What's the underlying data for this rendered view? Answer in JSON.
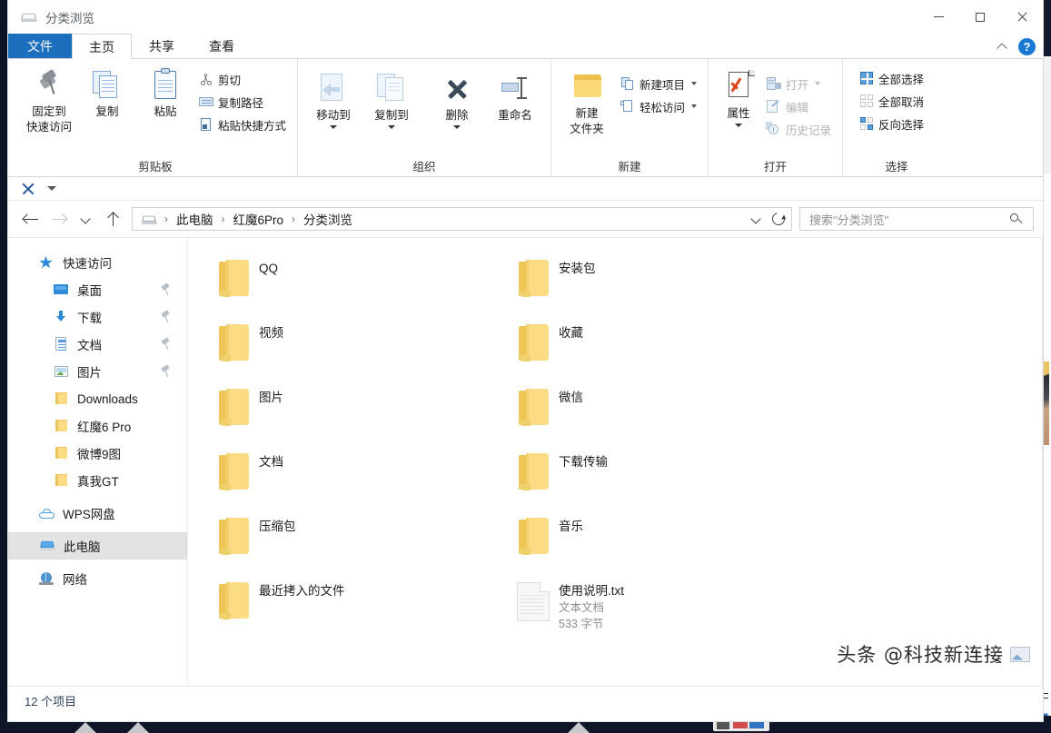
{
  "window": {
    "title": "分类浏览",
    "title_icon": "this-pc-icon",
    "controls": {
      "minimize": "—",
      "maximize": "□",
      "close": "✕"
    }
  },
  "ribbon": {
    "tabs": [
      {
        "label": "文件",
        "state": "file"
      },
      {
        "label": "主页",
        "state": "active"
      },
      {
        "label": "共享",
        "state": "normal"
      },
      {
        "label": "查看",
        "state": "normal"
      }
    ],
    "collapse_icon": "chevron-up-icon",
    "help_label": "?",
    "groups": [
      {
        "label": "剪贴板",
        "big_buttons": [
          {
            "label_line1": "固定到",
            "label_line2": "快速访问",
            "icon": "pin-icon"
          },
          {
            "label_line1": "复制",
            "label_line2": "",
            "icon": "copy-icon"
          },
          {
            "label_line1": "粘贴",
            "label_line2": "",
            "icon": "paste-icon"
          }
        ],
        "small_buttons": [
          {
            "label": "剪切",
            "icon": "scissors-icon"
          },
          {
            "label": "复制路径",
            "icon": "copy-path-icon"
          },
          {
            "label": "粘贴快捷方式",
            "icon": "paste-shortcut-icon"
          }
        ]
      },
      {
        "label": "组织",
        "big_buttons": [
          {
            "label_line1": "移动到",
            "label_line2": "",
            "icon": "move-to-icon"
          },
          {
            "label_line1": "复制到",
            "label_line2": "",
            "icon": "copy-to-icon"
          },
          {
            "label_line1": "删除",
            "label_line2": "",
            "icon": "delete-icon"
          },
          {
            "label_line1": "重命名",
            "label_line2": "",
            "icon": "rename-icon"
          }
        ],
        "small_buttons": []
      },
      {
        "label": "新建",
        "big_buttons": [
          {
            "label_line1": "新建",
            "label_line2": "文件夹",
            "icon": "new-folder-icon"
          }
        ],
        "small_buttons": [
          {
            "label": "新建项目",
            "icon": "new-item-icon"
          },
          {
            "label": "轻松访问",
            "icon": "easy-access-icon"
          }
        ]
      },
      {
        "label": "打开",
        "big_buttons": [
          {
            "label_line1": "属性",
            "label_line2": "",
            "icon": "properties-icon"
          }
        ],
        "small_buttons": [
          {
            "label": "打开",
            "icon": "open-icon"
          },
          {
            "label": "编辑",
            "icon": "edit-icon"
          },
          {
            "label": "历史记录",
            "icon": "history-icon"
          }
        ]
      },
      {
        "label": "选择",
        "big_buttons": [],
        "small_buttons": [
          {
            "label": "全部选择",
            "icon": "select-all-icon"
          },
          {
            "label": "全部取消",
            "icon": "select-none-icon"
          },
          {
            "label": "反向选择",
            "icon": "invert-selection-icon"
          }
        ]
      }
    ]
  },
  "address": {
    "back_icon": "arrow-left-icon",
    "forward_icon": "arrow-right-icon",
    "recent_icon": "chevron-down-icon",
    "up_icon": "arrow-up-icon",
    "breadcrumb": [
      "此电脑",
      "红魔6Pro",
      "分类浏览"
    ],
    "dropdown_icon": "chevron-down-icon",
    "refresh_icon": "refresh-icon",
    "separator": "›"
  },
  "search": {
    "placeholder": "搜索\"分类浏览\"",
    "value": "",
    "icon": "search-icon"
  },
  "sidebar": {
    "items": [
      {
        "label": "快速访问",
        "icon": "star-icon",
        "level": "root",
        "pinned": false,
        "selected": false
      },
      {
        "label": "桌面",
        "icon": "desktop-icon",
        "level": "child",
        "pinned": true,
        "selected": false
      },
      {
        "label": "下载",
        "icon": "download-icon",
        "level": "child",
        "pinned": true,
        "selected": false
      },
      {
        "label": "文档",
        "icon": "document-icon",
        "level": "child",
        "pinned": true,
        "selected": false
      },
      {
        "label": "图片",
        "icon": "pictures-icon",
        "level": "child",
        "pinned": true,
        "selected": false
      },
      {
        "label": "Downloads",
        "icon": "folder-icon",
        "level": "child",
        "pinned": false,
        "selected": false
      },
      {
        "label": "红魔6 Pro",
        "icon": "folder-icon",
        "level": "child",
        "pinned": false,
        "selected": false
      },
      {
        "label": "微博9图",
        "icon": "folder-icon",
        "level": "child",
        "pinned": false,
        "selected": false
      },
      {
        "label": "真我GT",
        "icon": "folder-icon",
        "level": "child",
        "pinned": false,
        "selected": false
      },
      {
        "label": "WPS网盘",
        "icon": "cloud-icon",
        "level": "root",
        "pinned": false,
        "selected": false
      },
      {
        "label": "此电脑",
        "icon": "this-pc-icon",
        "level": "root",
        "pinned": false,
        "selected": true
      },
      {
        "label": "网络",
        "icon": "network-icon",
        "level": "root",
        "pinned": false,
        "selected": false
      }
    ]
  },
  "files": [
    {
      "name": "QQ",
      "type": "folder",
      "meta1": "",
      "meta2": ""
    },
    {
      "name": "视频",
      "type": "folder",
      "meta1": "",
      "meta2": ""
    },
    {
      "name": "图片",
      "type": "folder",
      "meta1": "",
      "meta2": ""
    },
    {
      "name": "文档",
      "type": "folder",
      "meta1": "",
      "meta2": ""
    },
    {
      "name": "压缩包",
      "type": "folder",
      "meta1": "",
      "meta2": ""
    },
    {
      "name": "最近拷入的文件",
      "type": "folder",
      "meta1": "",
      "meta2": ""
    },
    {
      "name": "安装包",
      "type": "folder",
      "meta1": "",
      "meta2": ""
    },
    {
      "name": "收藏",
      "type": "folder",
      "meta1": "",
      "meta2": ""
    },
    {
      "name": "微信",
      "type": "folder",
      "meta1": "",
      "meta2": ""
    },
    {
      "name": "下载传输",
      "type": "folder",
      "meta1": "",
      "meta2": ""
    },
    {
      "name": "音乐",
      "type": "folder",
      "meta1": "",
      "meta2": ""
    },
    {
      "name": "使用说明.txt",
      "type": "textfile",
      "meta1": "文本文档",
      "meta2": "533 字节"
    }
  ],
  "status": {
    "item_count": "12 个项目"
  },
  "watermark": {
    "text": "头条 @科技新连接"
  },
  "colors": {
    "accent_blue": "#1c6fbd",
    "folder_yellow": "#fbdc84",
    "folder_yellow_dark": "#edc655",
    "selection_grey": "#e3e3e3",
    "taskbar_dark": "#0e1628"
  }
}
